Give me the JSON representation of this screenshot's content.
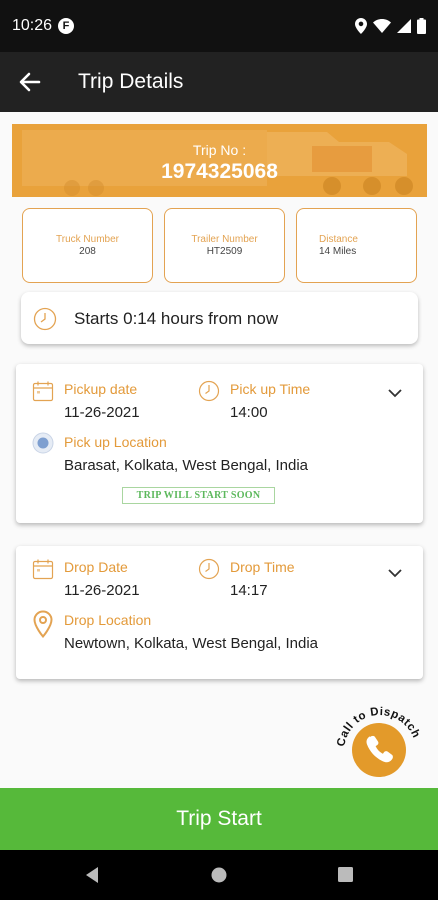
{
  "status_bar": {
    "time": "10:26",
    "app_badge": "F",
    "icons": [
      "location-icon",
      "wifi-icon",
      "signal-icon",
      "battery-icon"
    ]
  },
  "app_bar": {
    "title": "Trip Details",
    "back_icon": "back-arrow-icon"
  },
  "trip": {
    "label": "Trip No :",
    "number": "1974325068"
  },
  "info": [
    {
      "label": "Truck Number",
      "value": "208"
    },
    {
      "label": "Trailer Number",
      "value": "HT2509"
    },
    {
      "label": "Distance",
      "value": "14 Miles"
    }
  ],
  "starts_text": "Starts 0:14 hours from now",
  "pickup": {
    "date_label": "Pickup date",
    "date": "11-26-2021",
    "time_label": "Pick up Time",
    "time": "14:00",
    "location_label": "Pick up Location",
    "location": "Barasat, Kolkata, West Bengal, India",
    "badge": "TRIP WILL START SOON"
  },
  "drop": {
    "date_label": "Drop Date",
    "date": "11-26-2021",
    "time_label": "Drop Time",
    "time": "14:17",
    "location_label": "Drop Location",
    "location": "Newtown, Kolkata, West Bengal, India"
  },
  "dispatch_label": "Call to Dispatch",
  "start_button": "Trip Start",
  "colors": {
    "accent": "#e39a3a",
    "banner": "#e9a23b",
    "start": "#56b93a",
    "dispatch": "#e39a2a",
    "badge_green": "#5cb85c"
  }
}
